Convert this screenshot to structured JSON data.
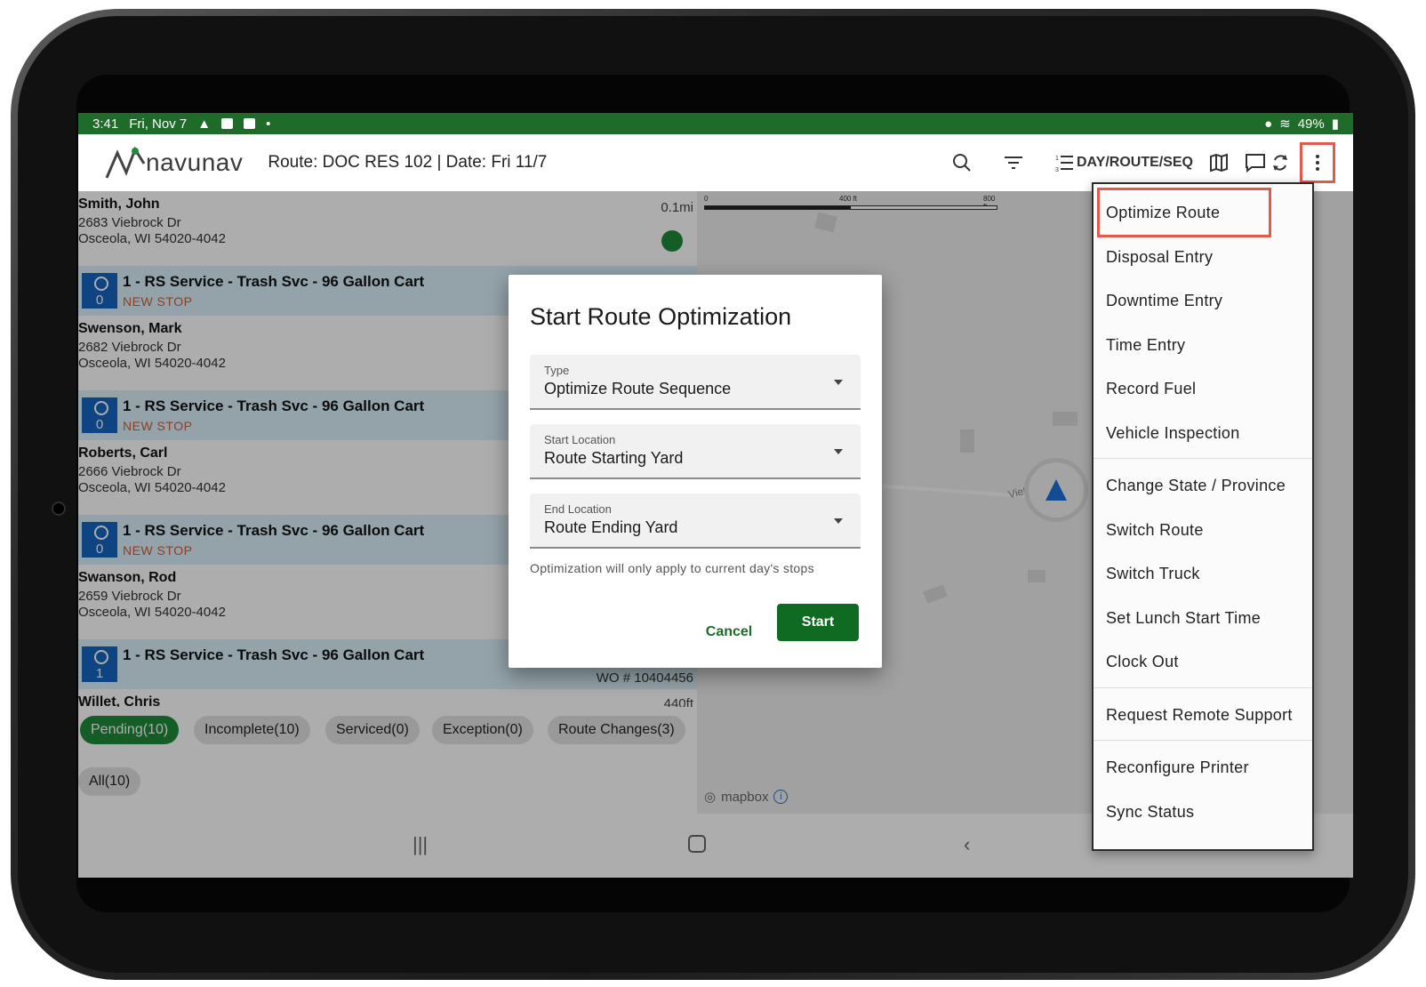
{
  "status_bar": {
    "time": "3:41",
    "date": "Fri, Nov 7",
    "battery": "49%"
  },
  "app": {
    "logo_text": "navunav",
    "route_title": "Route: DOC RES 102 | Date: Fri 11/7",
    "sort_label": "DAY/ROUTE/SEQ"
  },
  "stops": [
    {
      "name": "Smith, John",
      "street": "2683 Viebrock Dr",
      "city": "Osceola, WI 54020-4042",
      "distance": "0.1mi"
    },
    {
      "name": "Swenson, Mark",
      "street": "2682 Viebrock Dr",
      "city": "Osceola, WI 54020-4042",
      "distance": ""
    },
    {
      "name": "Roberts, Carl",
      "street": "2666 Viebrock Dr",
      "city": "Osceola, WI 54020-4042",
      "distance": ""
    },
    {
      "name": "Swanson, Rod",
      "street": "2659 Viebrock Dr",
      "city": "Osceola, WI 54020-4042",
      "distance": ""
    },
    {
      "name": "Willet, Chris",
      "street": "",
      "city": "",
      "distance": "440ft"
    }
  ],
  "services": [
    {
      "label": "1 - RS Service - Trash Svc - 96 Gallon Cart",
      "count": "0",
      "status": "NEW STOP",
      "wo": ""
    },
    {
      "label": "1 - RS Service - Trash Svc - 96 Gallon Cart",
      "count": "0",
      "status": "NEW STOP",
      "wo": ""
    },
    {
      "label": "1 - RS Service - Trash Svc - 96 Gallon Cart",
      "count": "0",
      "status": "NEW STOP",
      "wo": ""
    },
    {
      "label": "1 - RS Service - Trash Svc - 96 Gallon Cart",
      "count": "1",
      "status": "",
      "wo": "WO # 10404456"
    }
  ],
  "tabs": [
    "Pending(10)",
    "Incomplete(10)",
    "Serviced(0)",
    "Exception(0)",
    "Route Changes(3)",
    "All(10)"
  ],
  "map": {
    "scale_0": "0",
    "scale_1": "400 ft",
    "scale_2": "800 ft",
    "street_label": "Viet",
    "attribution": "mapbox"
  },
  "menu": {
    "items": [
      "Optimize Route",
      "Disposal Entry",
      "Downtime Entry",
      "Time Entry",
      "Record Fuel",
      "Vehicle Inspection",
      "Change State / Province",
      "Switch Route",
      "Switch Truck",
      "Set Lunch Start Time",
      "Clock Out",
      "Request Remote Support",
      "Reconfigure Printer",
      "Sync Status"
    ]
  },
  "dialog": {
    "title": "Start Route Optimization",
    "type_label": "Type",
    "type_value": "Optimize Route Sequence",
    "start_label": "Start Location",
    "start_value": "Route Starting Yard",
    "end_label": "End Location",
    "end_value": "Route Ending Yard",
    "note": "Optimization will only apply to current day's stops",
    "cancel": "Cancel",
    "start": "Start"
  },
  "colors": {
    "primary": "#1f6b2a",
    "accent_green": "#1f8a3a",
    "highlight": "#e05a4e",
    "service_blue": "#1565c0"
  }
}
